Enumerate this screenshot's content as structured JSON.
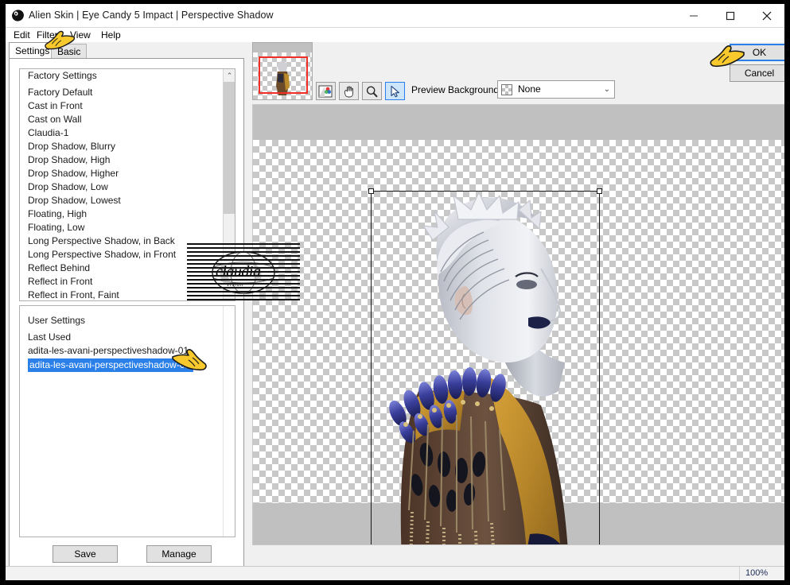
{
  "window": {
    "title": "Alien Skin | Eye Candy 5 Impact | Perspective Shadow",
    "app_icon": "alienskin-logo-icon",
    "minimize_label": "—",
    "maximize_label": "□",
    "close_label": "✕"
  },
  "menu": {
    "items": [
      {
        "label": "Edit"
      },
      {
        "label": "Filter"
      },
      {
        "label": "View"
      },
      {
        "label": "Help"
      }
    ]
  },
  "tabs": [
    {
      "label": "Settings",
      "active": true
    },
    {
      "label": "Basic",
      "active": false
    }
  ],
  "factory_settings": {
    "header": "Factory Settings",
    "items": [
      "Factory Default",
      "Cast in Front",
      "Cast on Wall",
      "Claudia-1",
      "Drop Shadow, Blurry",
      "Drop Shadow, High",
      "Drop Shadow, Higher",
      "Drop Shadow, Low",
      "Drop Shadow, Lowest",
      "Floating, High",
      "Floating, Low",
      "Long Perspective Shadow, in Back",
      "Long Perspective Shadow, in Front",
      "Reflect Behind",
      "Reflect in Front",
      "Reflect in Front, Faint"
    ],
    "scroll_up_glyph": "⌃"
  },
  "user_settings": {
    "header": "User Settings",
    "items": [
      {
        "label": "Last Used",
        "selected": false
      },
      {
        "label": "adita-les-avani-perspectiveshadow-01",
        "selected": false
      },
      {
        "label": "adita-les-avani-perspectiveshadow-02",
        "selected": true
      }
    ]
  },
  "panel_buttons": {
    "save": "Save",
    "manage": "Manage"
  },
  "toolbar": {
    "tools": [
      {
        "name": "compare-preview-tool",
        "active": false
      },
      {
        "name": "hand-pan-tool",
        "active": false
      },
      {
        "name": "zoom-magnifier-tool",
        "active": false
      },
      {
        "name": "arrow-select-tool",
        "active": true
      }
    ],
    "preview_background_label": "Preview Background:",
    "preview_background_value": "None",
    "dropdown_arrow": "⌄"
  },
  "dialog_buttons": {
    "ok": "OK",
    "cancel": "Cancel"
  },
  "status_bar": {
    "zoom_level": "100%"
  },
  "watermark": {
    "text": "claudia",
    "subtext": "vision"
  },
  "colors": {
    "accent_blue": "#2a7fe8",
    "selection_red": "#f03028",
    "canvas_gray": "#c0c0c0",
    "panel_gray": "#f0f0f0",
    "window_white": "#ffffff",
    "hand_cursor_yellow": "#f7c92c",
    "fabric_gold": "#c08a28",
    "bead_blue": "#3a3f9c"
  }
}
